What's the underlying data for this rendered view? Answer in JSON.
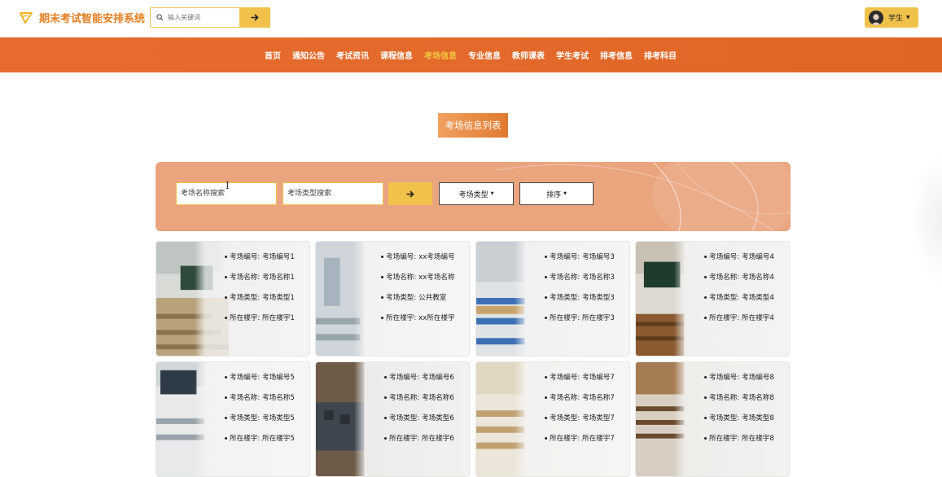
{
  "header": {
    "site_title": "期末考试智能安排系统",
    "search_placeholder": "输入关键词",
    "user_label": "学生"
  },
  "nav": {
    "items": [
      "首页",
      "通知公告",
      "考试资讯",
      "课程信息",
      "考场信息",
      "专业信息",
      "教师课表",
      "学生考试",
      "排考信息",
      "排考科目"
    ],
    "active_index": 4
  },
  "section_title": "考场信息列表",
  "filters": {
    "name_placeholder": "考场名称搜索",
    "type_placeholder": "考场类型搜索",
    "type_dropdown": "考场类型",
    "sort_dropdown": "排序"
  },
  "colors": {
    "accent": "#e86b2e",
    "yellow": "#f0c24b",
    "active_nav": "#f5c542",
    "panel": "#eaa57f"
  },
  "rooms": [
    {
      "rows": [
        "考场编号: 考场编号1",
        "考场名称: 考场名称1",
        "考场类型: 考场类型1",
        "所在楼宇: 所在楼宇1"
      ]
    },
    {
      "rows": [
        "考场编号: xx考场编号",
        "考场名称: xx考场名称",
        "考场类型: 公共教室",
        "所在楼宇: xx所在楼宇"
      ]
    },
    {
      "rows": [
        "考场编号: 考场编号3",
        "考场名称: 考场名称3",
        "考场类型: 考场类型3",
        "所在楼宇: 所在楼宇3"
      ]
    },
    {
      "rows": [
        "考场编号: 考场编号4",
        "考场名称: 考场名称4",
        "考场类型: 考场类型4",
        "所在楼宇: 所在楼宇4"
      ]
    },
    {
      "rows": [
        "考场编号: 考场编号5",
        "考场名称: 考场名称5",
        "考场类型: 考场类型5",
        "所在楼宇: 所在楼宇5"
      ]
    },
    {
      "rows": [
        "考场编号: 考场编号6",
        "考场名称: 考场名称6",
        "考场类型: 考场类型6",
        "所在楼宇: 所在楼宇6"
      ]
    },
    {
      "rows": [
        "考场编号: 考场编号7",
        "考场名称: 考场名称7",
        "考场类型: 考场类型7",
        "所在楼宇: 所在楼宇7"
      ]
    },
    {
      "rows": [
        "考场编号: 考场编号8",
        "考场名称: 考场名称8",
        "考场类型: 考场类型8",
        "所在楼宇: 所在楼宇8"
      ]
    }
  ]
}
